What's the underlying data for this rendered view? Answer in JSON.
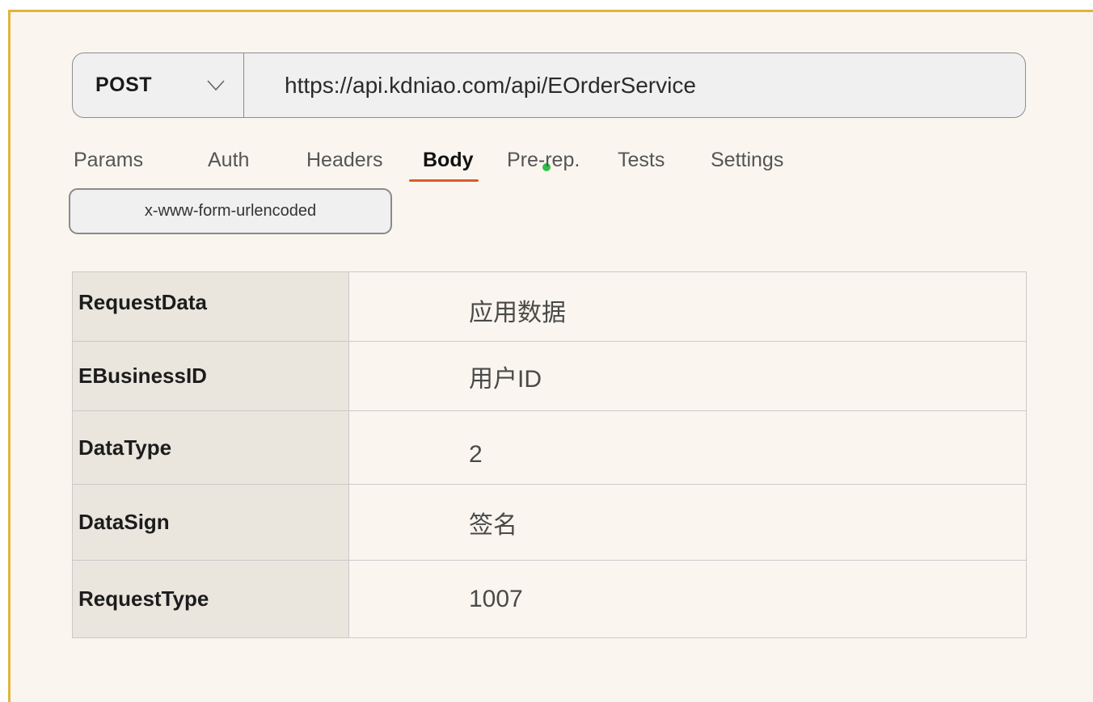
{
  "request": {
    "method": "POST",
    "url": "https://api.kdniao.com/api/EOrderService"
  },
  "tabs": [
    {
      "label": "Params",
      "active": false
    },
    {
      "label": "Auth",
      "active": false
    },
    {
      "label": "Headers",
      "active": false
    },
    {
      "label": "Body",
      "active": true
    },
    {
      "label": "Pre-rep.",
      "active": false
    },
    {
      "label": "Tests",
      "active": false
    },
    {
      "label": "Settings",
      "active": false
    }
  ],
  "body_type": "x-www-form-urlencoded",
  "params": [
    {
      "key": "RequestData",
      "value": "应用数据"
    },
    {
      "key": "EBusinessID",
      "value": "用户ID"
    },
    {
      "key": "DataType",
      "value": "2"
    },
    {
      "key": "DataSign",
      "value": "签名"
    },
    {
      "key": "RequestType",
      "value": "1007"
    }
  ],
  "colors": {
    "frame_border": "#e0b43c",
    "active_tab_underline": "#e0592a",
    "body_indicator_dot": "#2fc04b"
  },
  "icons": {
    "method_dropdown": "chevron-down-icon"
  }
}
